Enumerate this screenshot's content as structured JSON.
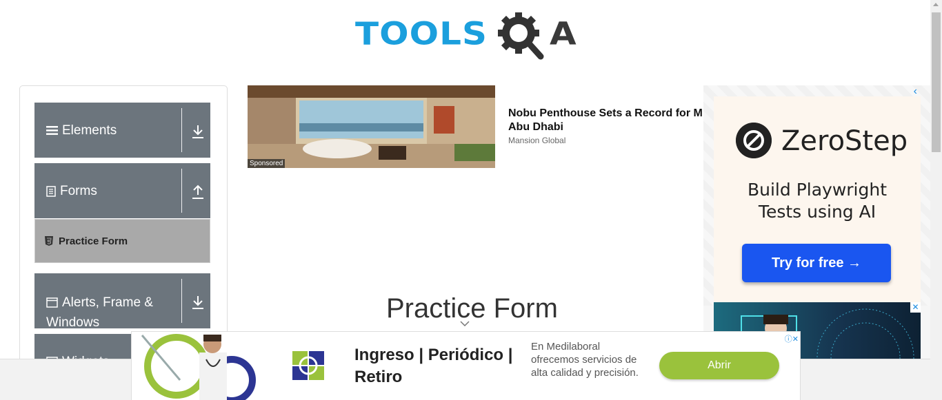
{
  "logo": {
    "text_main": "TOOLS",
    "text_end": "A"
  },
  "sidebar": {
    "groups": [
      {
        "label": "Elements",
        "icon": "list-icon",
        "toggle": "download-icon"
      },
      {
        "label": "Forms",
        "icon": "form-icon",
        "toggle": "upload-icon"
      },
      {
        "label": "Alerts, Frame & Windows",
        "icon": "window-icon",
        "toggle": "download-icon"
      },
      {
        "label": "Widgets",
        "icon": "widget-icon",
        "toggle": "download-icon"
      }
    ],
    "forms_item": {
      "label": "Practice Form"
    }
  },
  "sponsored_article": {
    "badge": "Sponsored",
    "headline": "Nobu Penthouse Sets a Record for M Abu Dhabi",
    "source": "Mansion Global"
  },
  "right_ad": {
    "brand": "ZeroStep",
    "copy": "Build Playwright Tests using AI",
    "cta": "Try for free →"
  },
  "main": {
    "title": "Practice Form"
  },
  "bottom_banner": {
    "title": "Ingreso | Periódico | Retiro",
    "description": "En Medilaboral ofrecemos servicios de alta calidad y precisión.",
    "cta": "Abrir"
  },
  "colors": {
    "accent": "#1b9fdd",
    "sidebar_header": "#6c757d",
    "active_item": "#a9a9a9",
    "cta_blue": "#1a56f0",
    "cta_green": "#9ac23c"
  }
}
